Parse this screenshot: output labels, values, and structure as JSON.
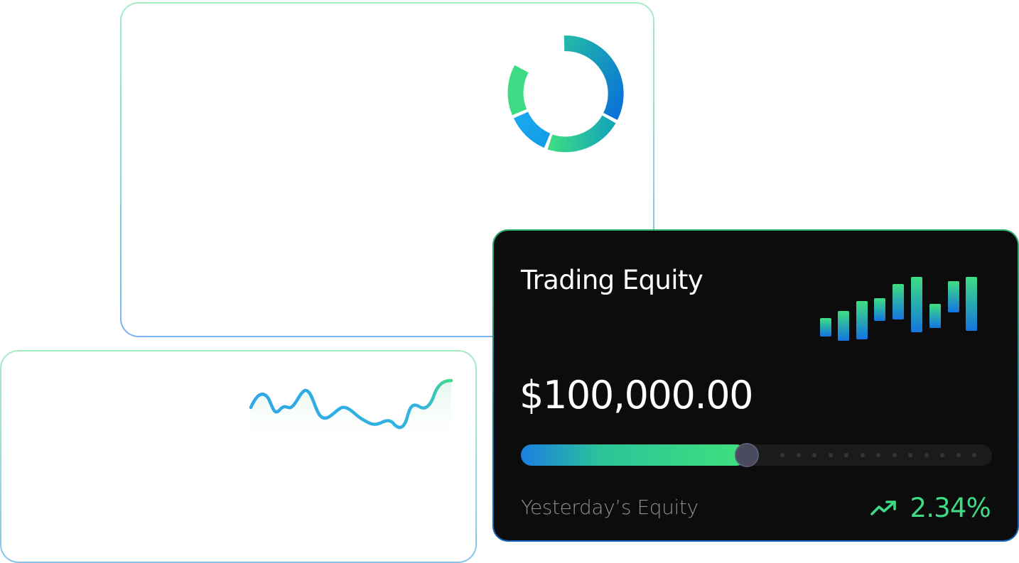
{
  "equity_card": {
    "title": "Trading Equity",
    "amount": "$100,000.00",
    "progress_fraction": 0.47,
    "yesterday_label": "Yesterday’s Equity",
    "change_percent": "2.34%",
    "trend_icon": "trend-up-icon"
  },
  "colors": {
    "accent_green": "#3ddc84",
    "accent_blue": "#1a7ee0",
    "card_dark": "#0c0c0c"
  }
}
